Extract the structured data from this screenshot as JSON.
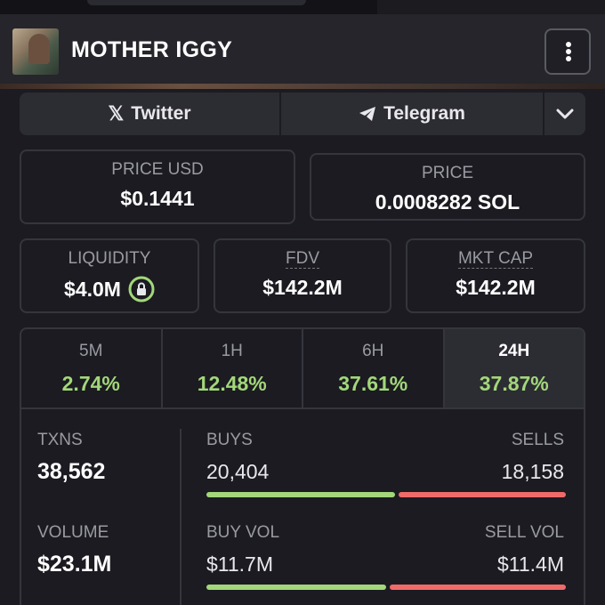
{
  "token": {
    "name": "MOTHER IGGY"
  },
  "links": {
    "twitter": "Twitter",
    "telegram": "Telegram"
  },
  "price_usd": {
    "label": "PRICE USD",
    "value": "$0.1441"
  },
  "price_native": {
    "label": "PRICE",
    "value": "0.0008282 SOL"
  },
  "liquidity": {
    "label": "LIQUIDITY",
    "value": "$4.0M"
  },
  "fdv": {
    "label": "FDV",
    "value": "$142.2M"
  },
  "mkt_cap": {
    "label": "MKT CAP",
    "value": "$142.2M"
  },
  "timeframes": [
    {
      "label": "5M",
      "change": "2.74%"
    },
    {
      "label": "1H",
      "change": "12.48%"
    },
    {
      "label": "6H",
      "change": "37.61%"
    },
    {
      "label": "24H",
      "change": "37.87%",
      "active": true
    }
  ],
  "stats": {
    "txns": {
      "label": "TXNS",
      "value": "38,562"
    },
    "buys": {
      "label": "BUYS",
      "value": "20,404",
      "share": 0.529
    },
    "sells": {
      "label": "SELLS",
      "value": "18,158",
      "share": 0.471
    },
    "volume": {
      "label": "VOLUME",
      "value": "$23.1M"
    },
    "buy_vol": {
      "label": "BUY VOL",
      "value": "$11.7M",
      "share": 0.506
    },
    "sell_vol": {
      "label": "SELL VOL",
      "value": "$11.4M",
      "share": 0.494
    }
  },
  "colors": {
    "positive": "#a3d77a",
    "negative": "#f06a6a",
    "background": "#1b1b21"
  }
}
